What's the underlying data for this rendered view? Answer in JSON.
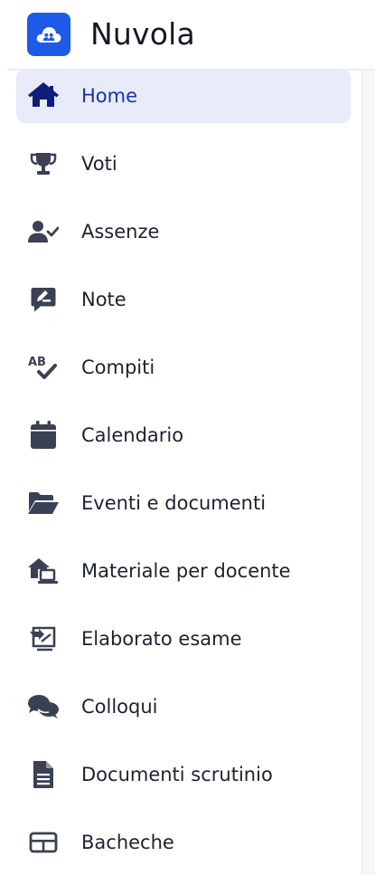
{
  "app": {
    "name": "Nuvola"
  },
  "colors": {
    "accent": "#1e59e8",
    "active_bg": "#e8ebf9",
    "active_text": "#1a33a8",
    "icon": "#3a4154"
  },
  "sidebar": {
    "items": [
      {
        "label": "Home",
        "icon": "home-icon",
        "active": true
      },
      {
        "label": "Voti",
        "icon": "trophy-icon"
      },
      {
        "label": "Assenze",
        "icon": "user-check-icon"
      },
      {
        "label": "Note",
        "icon": "note-icon"
      },
      {
        "label": "Compiti",
        "icon": "spellcheck-icon"
      },
      {
        "label": "Calendario",
        "icon": "calendar-icon"
      },
      {
        "label": "Eventi e documenti",
        "icon": "folder-open-icon"
      },
      {
        "label": "Materiale per docente",
        "icon": "house-laptop-icon"
      },
      {
        "label": "Elaborato esame",
        "icon": "screen-share-icon"
      },
      {
        "label": "Colloqui",
        "icon": "comments-icon"
      },
      {
        "label": "Documenti scrutinio",
        "icon": "document-icon"
      },
      {
        "label": "Bacheche",
        "icon": "board-icon"
      }
    ]
  }
}
